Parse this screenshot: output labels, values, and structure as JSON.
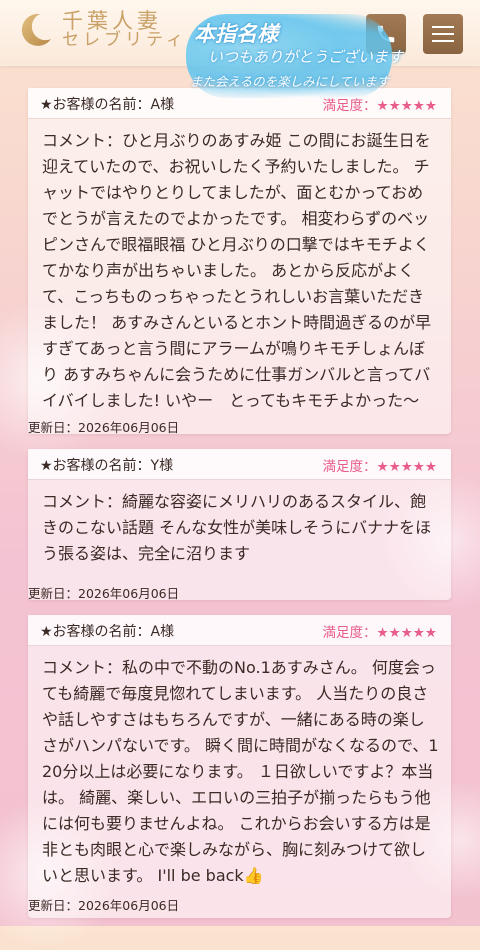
{
  "header": {
    "logo_line1": "千葉人妻",
    "logo_line2": "セレブリティ",
    "banner_line1": "本指名様",
    "banner_line2": "いつもありがとうございます",
    "banner_line3": "また会えるのを楽しみにしています"
  },
  "reviews": [
    {
      "customer": "★お客様の名前：A様",
      "satisfaction_label": "満足度：",
      "stars": "★★★★★",
      "comment": "コメント：ひと月ぶりのあすみ姫 この間にお誕生日を迎えていたので、お祝いしたく予約いたしました。 チャットではやりとりしてましたが、面とむかっておめでとうが言えたのでよかったです。 相変わらずのベッピンさんで眼福眼福 ひと月ぶりの口撃ではキモチよくてかなり声が出ちゃいました。 あとから反応がよくて、こっちものっちゃったとうれしいお言葉いただきました！ あすみさんといるとホント時間過ぎるのが早すぎてあっと言う間にアラームが鳴りキモチしょんぼり あすみちゃんに会うために仕事ガンバルと言ってバイバイしました! いやー　とってもキモチよかった〜",
      "updated": "更新日：2026年06月06日"
    },
    {
      "customer": "★お客様の名前：Y様",
      "satisfaction_label": "満足度：",
      "stars": "★★★★★",
      "comment": "コメント：綺麗な容姿にメリハリのあるスタイル、飽きのこない話題 そんな女性が美味しそうにバナナをほう張る姿は、完全に沼ります",
      "updated": "更新日：2026年06月06日"
    },
    {
      "customer": "★お客様の名前：A様",
      "satisfaction_label": "満足度：",
      "stars": "★★★★★",
      "comment": "コメント：私の中で不動のNo.1あすみさん。 何度会っても綺麗で毎度見惚れてしまいます。 人当たりの良さや話しやすさはもちろんですが、一緒にある時の楽しさがハンパないです。 瞬く間に時間がなくなるので、120分以上は必要になります。 １日欲しいですよ？本当は。 綺麗、楽しい、エロいの三拍子が揃ったらもう他には何も要りませんよね。 これからお会いする方は是非とも肉眼と心で楽しみながら、胸に刻みつけて欲しいと思います。 I'll be back👍",
      "updated": "更新日：2026年06月06日"
    }
  ]
}
